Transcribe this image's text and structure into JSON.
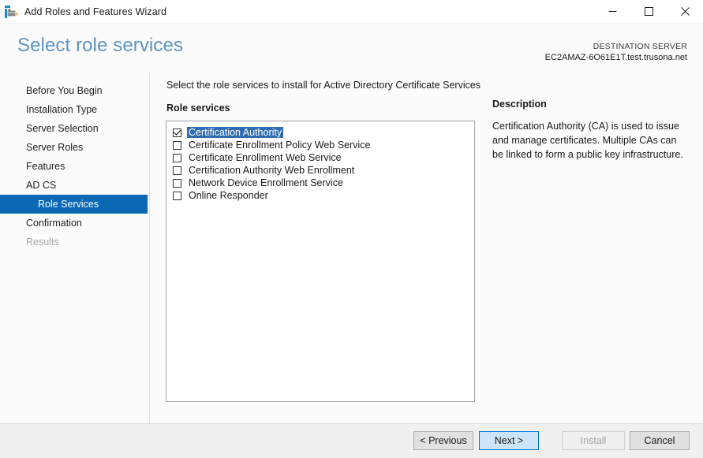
{
  "window": {
    "title": "Add Roles and Features Wizard",
    "icon": "wizard-toolbox-icon",
    "minimize_label": "Minimize",
    "maximize_label": "Maximize",
    "close_label": "Close"
  },
  "header": {
    "page_title": "Select role services",
    "destination_label": "DESTINATION SERVER",
    "destination_server": "EC2AMAZ-6O61E1T.test.trusona.net"
  },
  "sidebar": {
    "items": [
      {
        "label": "Before You Begin",
        "state": "normal",
        "indent": false
      },
      {
        "label": "Installation Type",
        "state": "normal",
        "indent": false
      },
      {
        "label": "Server Selection",
        "state": "normal",
        "indent": false
      },
      {
        "label": "Server Roles",
        "state": "normal",
        "indent": false
      },
      {
        "label": "Features",
        "state": "normal",
        "indent": false
      },
      {
        "label": "AD CS",
        "state": "normal",
        "indent": false
      },
      {
        "label": "Role Services",
        "state": "selected",
        "indent": true
      },
      {
        "label": "Confirmation",
        "state": "normal",
        "indent": false
      },
      {
        "label": "Results",
        "state": "disabled",
        "indent": false
      }
    ]
  },
  "main": {
    "instruction": "Select the role services to install for Active Directory Certificate Services",
    "section_label": "Role services",
    "role_services": [
      {
        "label": "Certification Authority",
        "checked": true,
        "selected": true
      },
      {
        "label": "Certificate Enrollment Policy Web Service",
        "checked": false,
        "selected": false
      },
      {
        "label": "Certificate Enrollment Web Service",
        "checked": false,
        "selected": false
      },
      {
        "label": "Certification Authority Web Enrollment",
        "checked": false,
        "selected": false
      },
      {
        "label": "Network Device Enrollment Service",
        "checked": false,
        "selected": false
      },
      {
        "label": "Online Responder",
        "checked": false,
        "selected": false
      }
    ]
  },
  "description": {
    "title": "Description",
    "text": "Certification Authority (CA) is used to issue and manage certificates. Multiple CAs can be linked to form a public key infrastructure."
  },
  "footer": {
    "previous_label": "< Previous",
    "next_label": "Next >",
    "install_label": "Install",
    "cancel_label": "Cancel"
  },
  "colors": {
    "accent_blue": "#0a68b4",
    "title_blue": "#5b93c4",
    "selection_blue": "#2f6cb0",
    "primary_button_fill": "#cce4f7",
    "primary_button_border": "#0078d7"
  }
}
